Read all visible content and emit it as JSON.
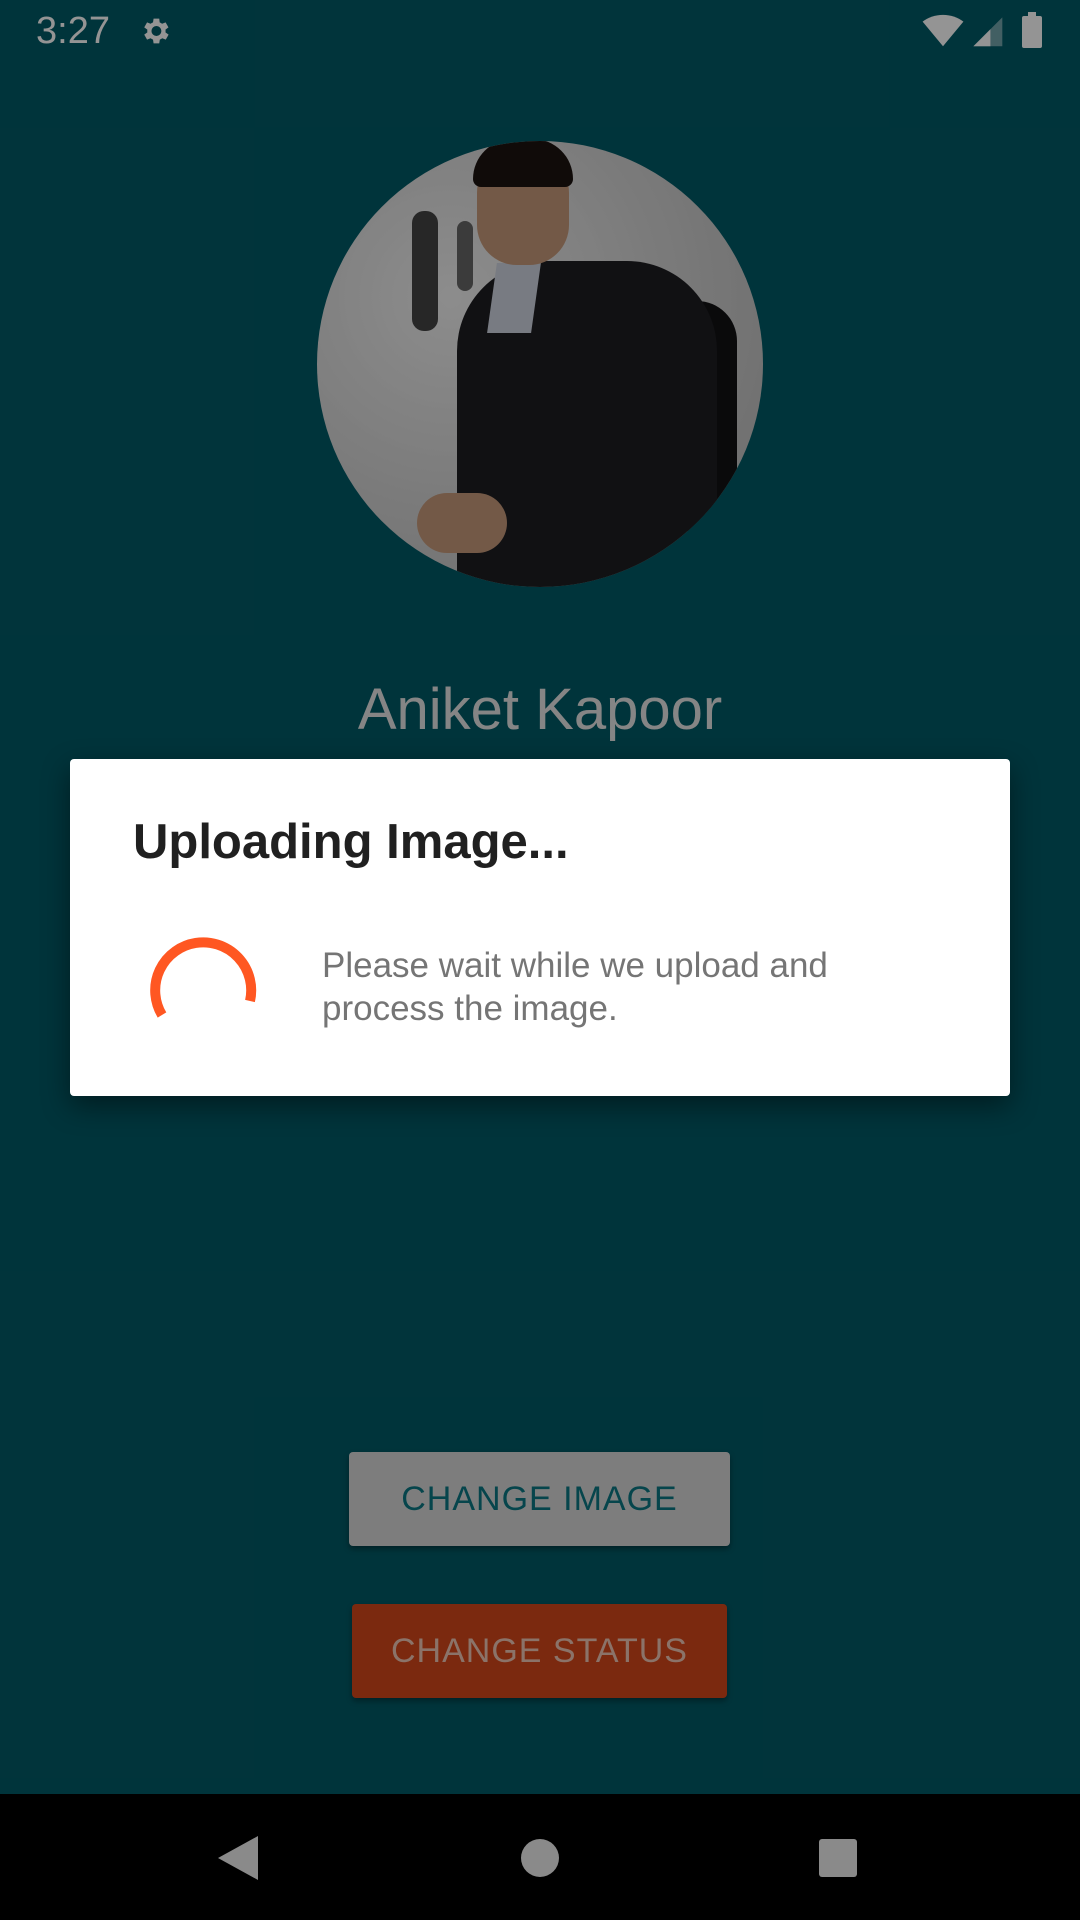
{
  "status_bar": {
    "time": "3:27"
  },
  "profile": {
    "name": "Aniket Kapoor"
  },
  "buttons": {
    "change_image": "CHANGE IMAGE",
    "change_status": "CHANGE STATUS"
  },
  "dialog": {
    "title": "Uploading Image...",
    "message": "Please wait while we upload and process the image."
  },
  "icons": {
    "status": [
      "gear-icon",
      "wifi-icon",
      "signal-icon",
      "battery-icon"
    ],
    "nav": [
      "back-icon",
      "home-icon",
      "recents-icon"
    ]
  },
  "colors": {
    "background": "#015a66",
    "change_status_button": "#d5481a",
    "change_image_button": "#d8d8d8",
    "spinner": "#ff5722"
  }
}
